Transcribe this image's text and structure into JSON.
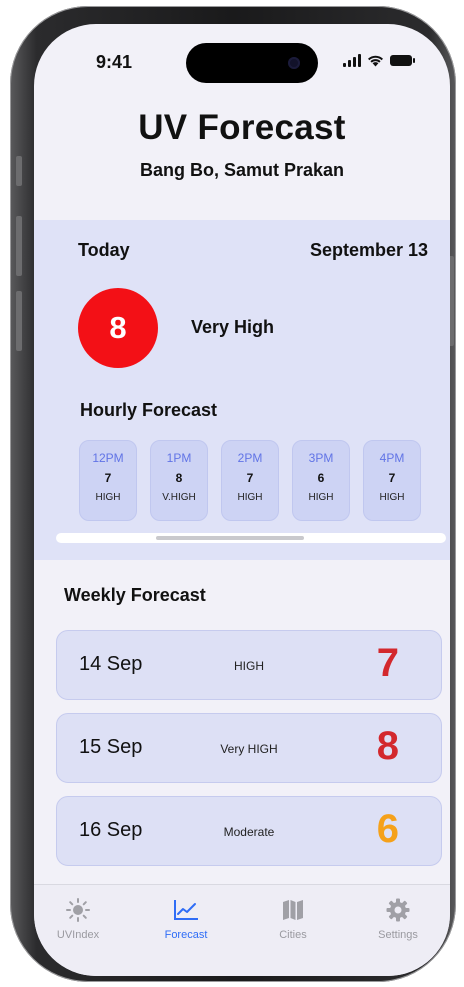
{
  "status_bar": {
    "time": "9:41"
  },
  "header": {
    "title": "UV Forecast",
    "location": "Bang Bo, Samut Prakan"
  },
  "today": {
    "label": "Today",
    "date": "September 13",
    "uv_index": "8",
    "uv_level": "Very High",
    "uv_color": "#f31016"
  },
  "hourly": {
    "title": "Hourly Forecast",
    "items": [
      {
        "time": "12PM",
        "value": "7",
        "level": "HIGH"
      },
      {
        "time": "1PM",
        "value": "8",
        "level": "V.HIGH"
      },
      {
        "time": "2PM",
        "value": "7",
        "level": "HIGH"
      },
      {
        "time": "3PM",
        "value": "6",
        "level": "HIGH"
      },
      {
        "time": "4PM",
        "value": "7",
        "level": "HIGH"
      }
    ]
  },
  "weekly": {
    "title": "Weekly Forecast",
    "items": [
      {
        "date": "14 Sep",
        "level": "HIGH",
        "value": "7",
        "color": "#d3282d"
      },
      {
        "date": "15 Sep",
        "level": "Very HIGH",
        "value": "8",
        "color": "#d3282d"
      },
      {
        "date": "16 Sep",
        "level": "Moderate",
        "value": "6",
        "color": "#f5a11a"
      }
    ]
  },
  "tabbar": {
    "items": [
      {
        "label": "UVIndex",
        "icon": "sun-icon"
      },
      {
        "label": "Forecast",
        "icon": "chart-icon",
        "active": true
      },
      {
        "label": "Cities",
        "icon": "map-icon"
      },
      {
        "label": "Settings",
        "icon": "gear-icon"
      }
    ],
    "active_color": "#2f6df6",
    "inactive_color": "#9a9aa0"
  }
}
